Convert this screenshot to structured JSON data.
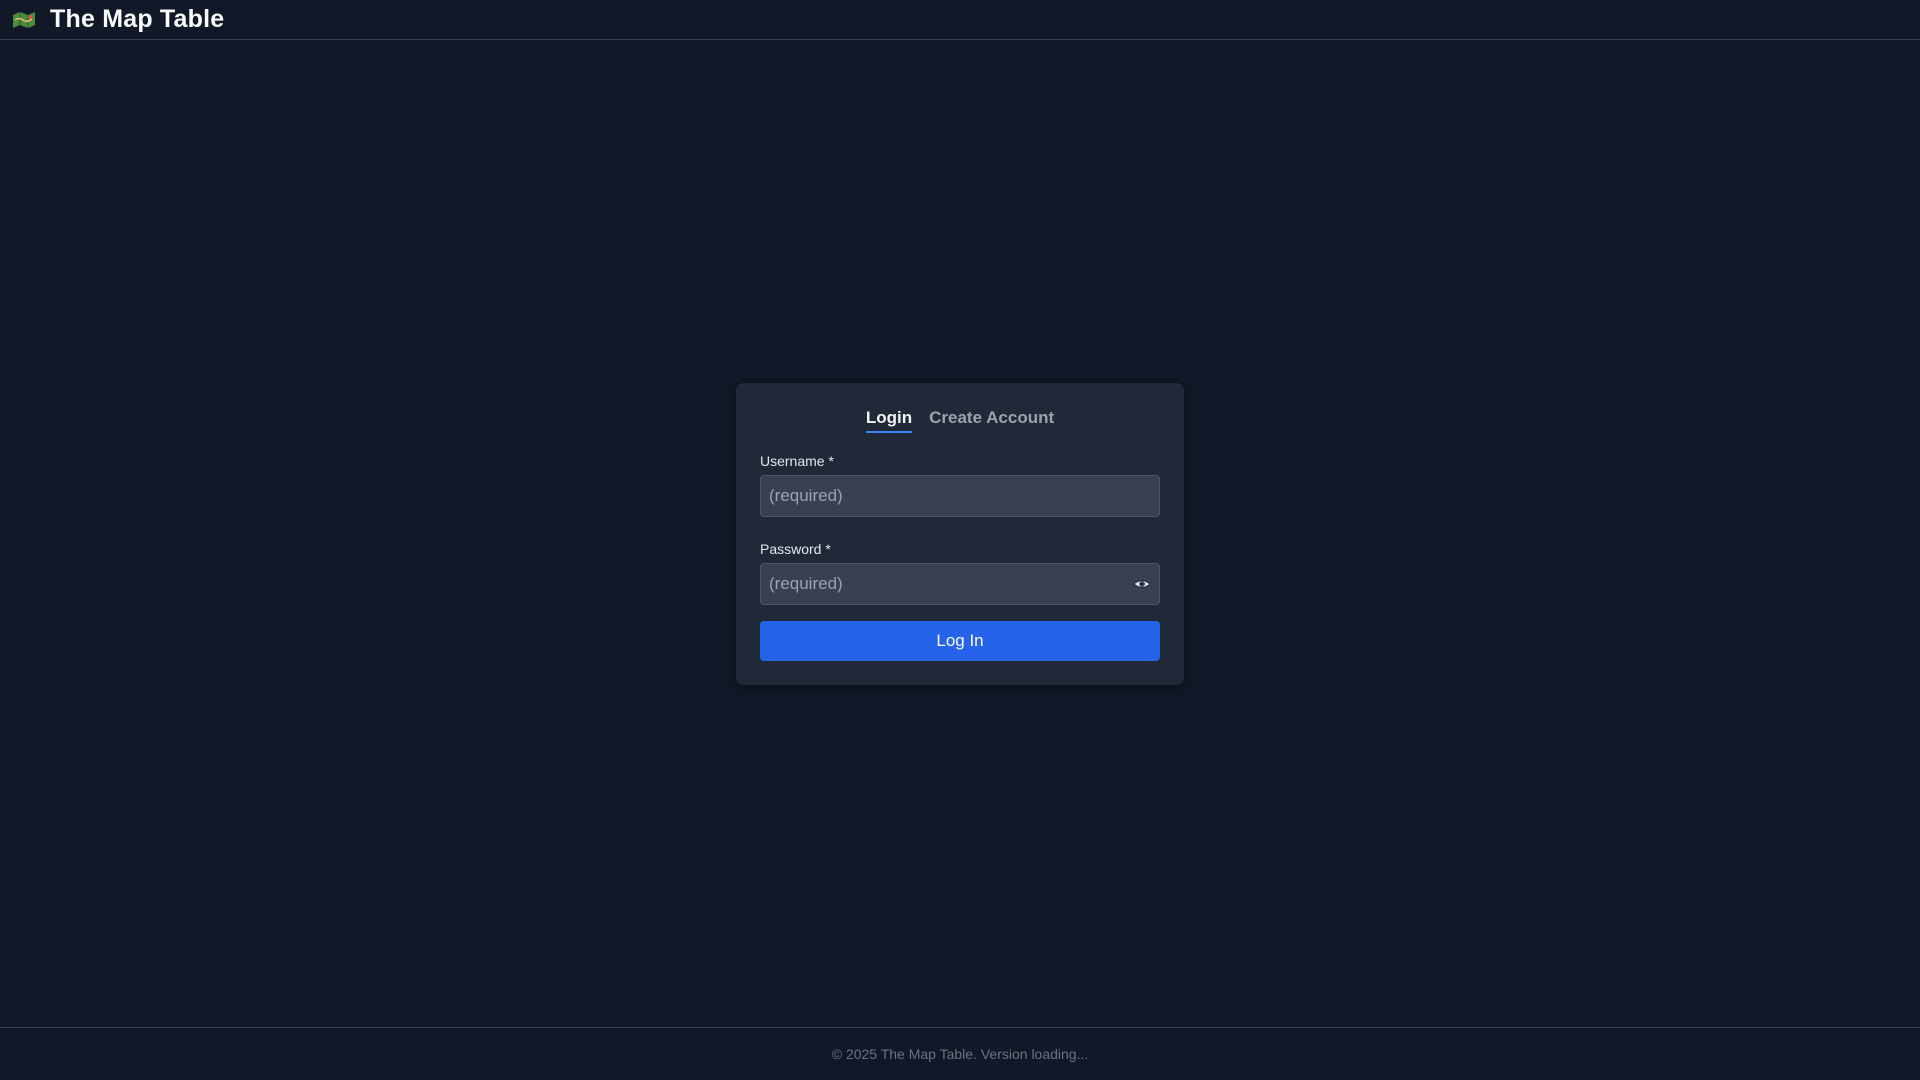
{
  "header": {
    "logo_icon": "map-icon",
    "title": "The Map Table"
  },
  "auth": {
    "tabs": [
      {
        "label": "Login",
        "active": true
      },
      {
        "label": "Create Account",
        "active": false
      }
    ],
    "username": {
      "label": "Username *",
      "placeholder": "(required)",
      "value": ""
    },
    "password": {
      "label": "Password *",
      "placeholder": "(required)",
      "value": "",
      "toggle_icon": "eye-icon"
    },
    "submit_label": "Log In"
  },
  "footer": {
    "text": "© 2025 The Map Table. Version loading..."
  },
  "colors": {
    "background": "#111827",
    "card": "#1f2937",
    "input": "#374151",
    "accent": "#2563eb",
    "tab_underline": "#3b82f6"
  }
}
